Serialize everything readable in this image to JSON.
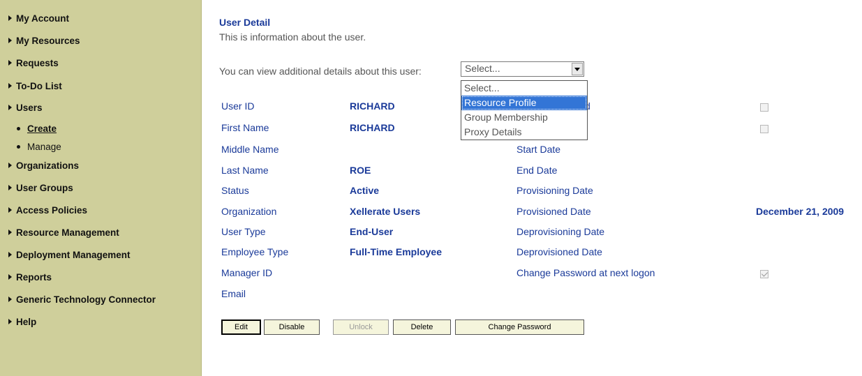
{
  "sidebar": {
    "items": [
      {
        "label": "My Account"
      },
      {
        "label": "My Resources"
      },
      {
        "label": "Requests"
      },
      {
        "label": "To-Do List"
      },
      {
        "label": "Users"
      },
      {
        "label": "Organizations"
      },
      {
        "label": "User Groups"
      },
      {
        "label": "Access Policies"
      },
      {
        "label": "Resource Management"
      },
      {
        "label": "Deployment Management"
      },
      {
        "label": "Reports"
      },
      {
        "label": "Generic Technology Connector"
      },
      {
        "label": "Help"
      }
    ],
    "users_sub": [
      {
        "label": "Create"
      },
      {
        "label": "Manage"
      }
    ]
  },
  "main": {
    "title": "User Detail",
    "subtitle": "This is information about the user.",
    "view_label": "You can view additional details about this user:",
    "select_value": "Select...",
    "options": [
      "Select...",
      "Resource Profile",
      "Group Membership",
      "Proxy Details"
    ],
    "partial_right_label": "d"
  },
  "fields_left": [
    {
      "label": "User ID",
      "value": "RICHARD"
    },
    {
      "label": "First Name",
      "value": "RICHARD"
    },
    {
      "label": "Middle Name",
      "value": ""
    },
    {
      "label": "Last Name",
      "value": "ROE"
    },
    {
      "label": "Status",
      "value": "Active"
    },
    {
      "label": "Organization",
      "value": "Xellerate Users"
    },
    {
      "label": "User Type",
      "value": "End-User"
    },
    {
      "label": "Employee Type",
      "value": "Full-Time Employee"
    },
    {
      "label": "Manager ID",
      "value": ""
    },
    {
      "label": "Email",
      "value": ""
    }
  ],
  "fields_right": [
    {
      "label": "Start Date",
      "value": ""
    },
    {
      "label": "End Date",
      "value": ""
    },
    {
      "label": "Provisioning Date",
      "value": ""
    },
    {
      "label": "Provisioned Date",
      "value": "December 21, 2009"
    },
    {
      "label": "Deprovisioning Date",
      "value": ""
    },
    {
      "label": "Deprovisioned Date",
      "value": ""
    },
    {
      "label": "Change Password at next logon",
      "value": ""
    }
  ],
  "buttons": {
    "edit": "Edit",
    "disable": "Disable",
    "unlock": "Unlock",
    "delete": "Delete",
    "change_password": "Change Password"
  }
}
